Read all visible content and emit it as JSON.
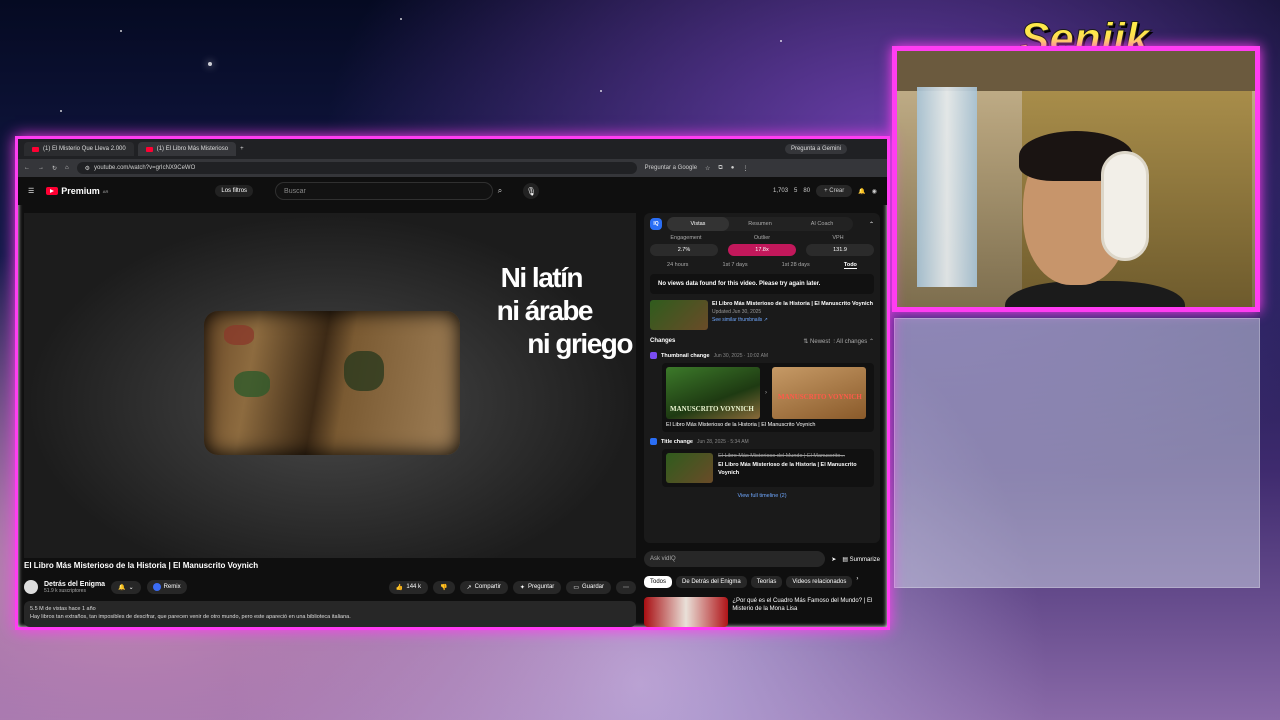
{
  "streamer": {
    "name": "Seniik"
  },
  "browser": {
    "tabs": [
      {
        "title": "(1) El Misterio Que Lleva 2.000"
      },
      {
        "title": "(1) El Libro Más Misterioso"
      }
    ],
    "gemini_chip": "Pregunta a Gemini",
    "url": "youtube.com/watch?v=grIcNX9CeWO",
    "ask_google": "Preguntar a Google"
  },
  "youtube": {
    "logo": "Premium",
    "logo_sup": "AR",
    "filters": "Los filtros",
    "search_placeholder": "Buscar",
    "stats": [
      "1,703",
      "5",
      "80"
    ],
    "create": "Crear",
    "notif_badge": "1"
  },
  "video": {
    "overlay_lines": [
      "Ni latín",
      "ni árabe",
      "ni griego"
    ],
    "title": "El Libro Más Misterioso de la Historia | El Manuscrito Voynich",
    "channel": "Detrás del Enigma",
    "subscribers": "51.9 k suscriptores",
    "remix": "Remix",
    "likes": "144 k",
    "share": "Compartir",
    "ask": "Preguntar",
    "save": "Guardar",
    "views_line": "5.5 M de vistas  hace 1 año",
    "description": "Hay libros tan extraños, tan imposibles de descifrar, que parecen venir de otro mundo, pero este apareció en una biblioteca italiana."
  },
  "vidiq": {
    "logo": "IQ",
    "tabs": [
      "Vistas",
      "Resumen",
      "AI Coach"
    ],
    "metric_labels": [
      "Engagement",
      "Outlier",
      "VPH"
    ],
    "metric_values": [
      "2.7%",
      "17.8x",
      "131.9"
    ],
    "periods": [
      "24 hours",
      "1st 7 days",
      "1st 28 days",
      "Todo"
    ],
    "notice": "No views data found for this video. Please try again later.",
    "video_title": "El Libro Más Misterioso de la Historia | El Manuscrito Voynich",
    "updated": "Updated Jun 30, 2025",
    "similar": "See similar thumbnails ↗",
    "changes": "Changes",
    "sort": "⇅ Newest",
    "filter": "All changes",
    "thumb_change": "Thumbnail change",
    "thumb_date": "Jun 30, 2025 · 10:02 AM",
    "thumb_old_text": "MANUSCRITO VOYNICH",
    "thumb_new_text": "MANUSCRITO VOYNICH",
    "thumb_caption": "El Libro Más Misterioso de la Historia | El Manuscrito Voynich",
    "title_change": "Title change",
    "title_date": "Jun 28, 2025 · 5:34 AM",
    "old_title": "El Libro Más Misterioso del Mundo | El Manuscrito...",
    "new_title": "El Libro Más Misterioso de la Historia | El Manuscrito Voynich",
    "view_all": "View full timeline (2)",
    "ask_placeholder": "Ask vidIQ",
    "summarize": "Summarize"
  },
  "chips": [
    "Todos",
    "De Detrás del Enigma",
    "Teorías",
    "Videos relacionados"
  ],
  "recommended": {
    "title": "¿Por qué es el Cuadro Más Famoso del Mundo? | El Misterio de la Mona Lisa"
  }
}
